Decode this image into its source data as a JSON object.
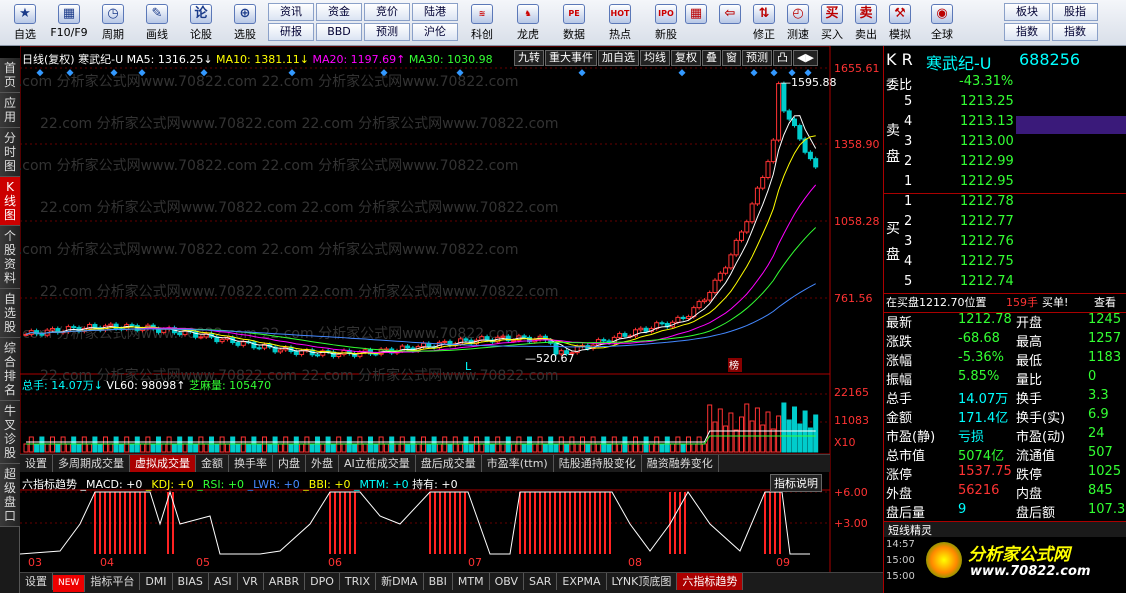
{
  "toolbar": {
    "items": [
      {
        "label": "自选",
        "icon": "★"
      },
      {
        "label": "F10/F9",
        "icon": "▦"
      },
      {
        "label": "周期",
        "icon": "◷"
      },
      {
        "label": "画线",
        "icon": "✎"
      },
      {
        "label": "论股",
        "icon": "论"
      },
      {
        "label": "选股",
        "icon": "⊕"
      }
    ],
    "pairs": [
      [
        "资讯",
        "研报"
      ],
      [
        "资金",
        "BBD"
      ],
      [
        "竞价",
        "预测"
      ],
      [
        "陆港",
        "沪伦"
      ]
    ],
    "items2": [
      {
        "label": "科创",
        "icon": "≋"
      },
      {
        "label": "龙虎",
        "icon": "♞"
      },
      {
        "label": "数据",
        "icon": "PE"
      },
      {
        "label": "热点",
        "icon": "HOT"
      },
      {
        "label": "新股",
        "icon": "IPO"
      }
    ],
    "items3": [
      {
        "label": "",
        "icon": "▦"
      },
      {
        "label": "",
        "icon": "⇦"
      },
      {
        "label": "修正",
        "icon": "⇅"
      },
      {
        "label": "测速",
        "icon": "◴"
      },
      {
        "label": "买入",
        "icon": "买"
      },
      {
        "label": "卖出",
        "icon": "卖"
      },
      {
        "label": "模拟",
        "icon": "⚒"
      },
      {
        "label": "全球",
        "icon": "◉"
      }
    ],
    "pairs2": [
      [
        "板块",
        "指数"
      ],
      [
        "股指",
        "指数"
      ]
    ]
  },
  "sidebar": [
    "首页",
    "应用",
    "分时图",
    "K线图",
    "个股资料",
    "自选股",
    "综合排名",
    "牛叉诊股",
    "超级盘口"
  ],
  "chart": {
    "title": "日线(复权)",
    "stock": "寒武纪-U",
    "ma5": "MA5: 1316.25↓",
    "ma10": "MA10: 1381.11↓",
    "ma20": "MA20: 1197.69↑",
    "ma30": "MA30: 1030.98",
    "buttons": [
      "九转",
      "重大事件",
      "加自选",
      "均线",
      "复权",
      "叠",
      "窗",
      "预测",
      "凸",
      "◀▶"
    ],
    "price_ticks": [
      "1655.61",
      "1358.90",
      "1058.28",
      "761.56"
    ],
    "high_label": "1595.88",
    "low_label": "520.67",
    "mark_l": "L",
    "mark_bang": "榜",
    "vol_header": {
      "total": "总手: 14.07万↓",
      "vl60": "VL60: 98098↑",
      "zhima": "芝麻量: 105470"
    },
    "vol_ticks": [
      "22165",
      "11083",
      "X10"
    ],
    "tabs1": [
      "设置",
      "多周期成交量",
      "虚拟成交量",
      "金额",
      "换手率",
      "内盘",
      "外盘",
      "AI立桩成交量",
      "盘后成交量",
      "市盈率(ttm)",
      "陆股通持股变化",
      "融资融券变化"
    ],
    "tabs1_active": 2,
    "ind_header": {
      "name": "六指标趋势",
      "macd": "_MACD: +0",
      "kdj": "_KDJ: +0",
      "rsi": "_RSI: +0",
      "lwr": "_LWR: +0",
      "bbi": "_BBI: +0",
      "mtm": "_MTM: +0",
      "hold": "持有: +0",
      "help": "指标说明"
    },
    "ind_ticks": [
      "+6.00",
      "+3.00"
    ],
    "months": [
      "03",
      "04",
      "05",
      "06",
      "07",
      "08",
      "09"
    ],
    "tabs2": [
      "设置",
      "NEW",
      "指标平台",
      "DMI",
      "BIAS",
      "ASI",
      "VR",
      "ARBR",
      "DPO",
      "TRIX",
      "新DMA",
      "BBI",
      "MTM",
      "OBV",
      "SAR",
      "EXPMA",
      "LYNK顶底图",
      "六指标趋势"
    ],
    "watermark": "22.com 分析家公式网www.70822.com"
  },
  "quote": {
    "name": "寒武纪-U",
    "code": "688256",
    "kr": "K R",
    "weibi_label": "委比",
    "weibi": "-43.31%",
    "sell": [
      [
        "5",
        "1213.25"
      ],
      [
        "4",
        "1213.13"
      ],
      [
        "3",
        "1213.00"
      ],
      [
        "2",
        "1212.99"
      ],
      [
        "1",
        "1212.95"
      ]
    ],
    "buy": [
      [
        "1",
        "1212.78"
      ],
      [
        "2",
        "1212.77"
      ],
      [
        "3",
        "1212.76"
      ],
      [
        "4",
        "1212.75"
      ],
      [
        "5",
        "1212.74"
      ]
    ],
    "sell_label": "卖盘",
    "buy_label": "买盘",
    "status": "在买盘1212.70位置",
    "status_vol": "159手",
    "status_type": "买单!",
    "status_more": "查看",
    "fields": [
      [
        "最新",
        "1212.78",
        "开盘",
        "1245"
      ],
      [
        "涨跌",
        "-68.68",
        "最高",
        "1257"
      ],
      [
        "涨幅",
        "-5.36%",
        "最低",
        "1183"
      ],
      [
        "振幅",
        "5.85%",
        "量比",
        "0"
      ],
      [
        "总手",
        "14.07万",
        "换手",
        "3.3"
      ],
      [
        "金额",
        "171.4亿",
        "换手(实)",
        "6.9"
      ],
      [
        "市盈(静)",
        "亏损",
        "市盈(动)",
        "24"
      ],
      [
        "总市值",
        "5074亿",
        "流通值",
        "507"
      ],
      [
        "涨停",
        "1537.75",
        "跌停",
        "1025"
      ],
      [
        "外盘",
        "56216",
        "内盘",
        "845"
      ],
      [
        "盘后量",
        "9",
        "盘后额",
        "107.3"
      ]
    ],
    "short_title": "短线精灵",
    "short_rows": [
      "14:57",
      "15:00",
      "15:00"
    ],
    "logo": "分析家公式网",
    "logo_url": "www.70822.com"
  },
  "chart_data": {
    "type": "candlestick",
    "months": [
      "03",
      "04",
      "05",
      "06",
      "07",
      "08",
      "09"
    ],
    "high": 1595.88,
    "low": 520.67,
    "price_ticks": [
      1655.61,
      1358.9,
      1058.28,
      761.56
    ]
  }
}
